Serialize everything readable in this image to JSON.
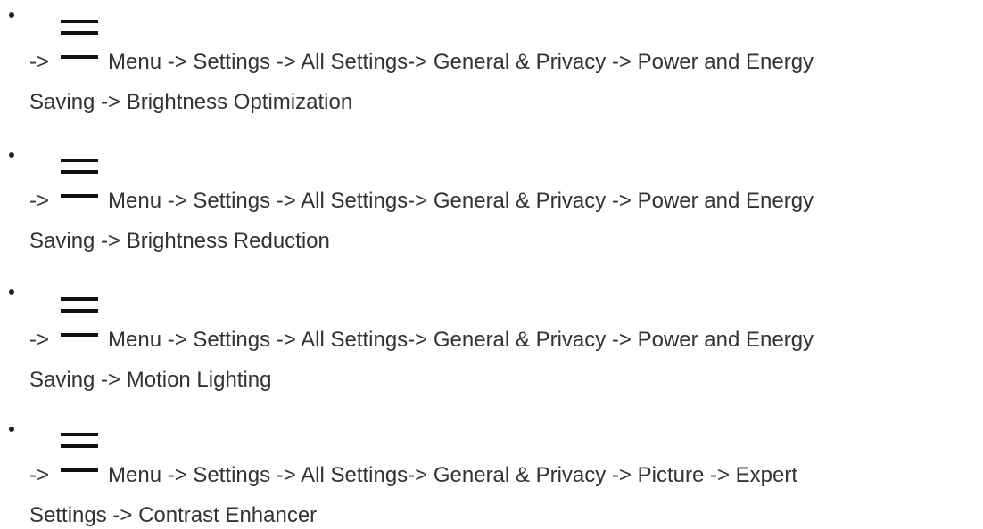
{
  "entries": [
    {
      "lead": "->",
      "path": "Menu -> Settings -> All Settings-> General & Privacy -> Power and Energy",
      "continuation": "Saving -> Brightness Optimization"
    },
    {
      "lead": "->",
      "path": "Menu -> Settings -> All Settings-> General & Privacy -> Power and Energy",
      "continuation": "Saving -> Brightness Reduction"
    },
    {
      "lead": "->",
      "path": "Menu -> Settings -> All Settings-> General & Privacy -> Power and Energy",
      "continuation": "Saving -> Motion Lighting"
    },
    {
      "lead": "->",
      "path": "Menu -> Settings -> All Settings-> General & Privacy -> Picture -> Expert",
      "continuation": "Settings -> Contrast Enhancer"
    }
  ],
  "icons": {
    "menu": "hamburger-menu-icon"
  }
}
